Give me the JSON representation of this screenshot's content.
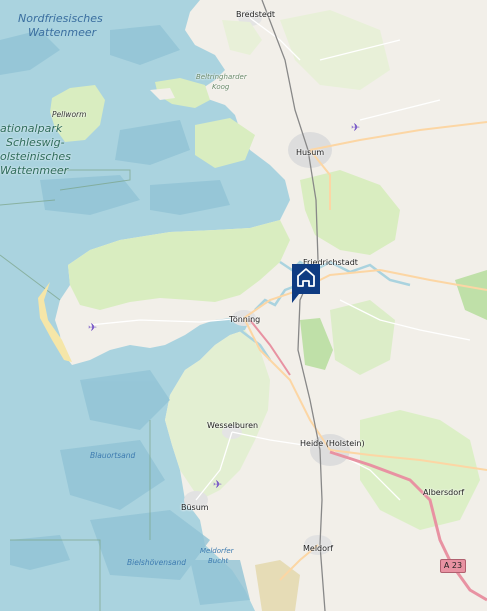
{
  "labels": {
    "nordfriesisches": "Nordfriesisches",
    "wattenmeer_nf": "Wattenmeer",
    "bredstedt": "Bredstedt",
    "beltringharder": "Beltringharder",
    "koog": "Koog",
    "pellworm": "Pellworm",
    "nationalpark_1": "ationalpark",
    "nationalpark_2": "Schleswig-",
    "nationalpark_3": "olsteinisches",
    "nationalpark_4": "Wattenmeer",
    "husum": "Husum",
    "friedrichstadt": "Friedrichstadt",
    "toenning": "Tönning",
    "wesselburen": "Wesselburen",
    "heide": "Heide (Holstein)",
    "albersdorf": "Albersdorf",
    "blauortsand": "Blauortsand",
    "buesum": "Büsum",
    "meldorfer": "Meldorfer",
    "bucht": "Bucht",
    "bielshoevensand": "Bielshövensand",
    "meldorf": "Meldorf",
    "a23": "A 23"
  },
  "icons": {
    "airport": "airport-icon",
    "marker": "home-marker-icon"
  },
  "colors": {
    "sea": "#aad3df",
    "land": "#f2efe9",
    "wetland_green": "#d9edc0",
    "urban": "#dddddd",
    "motorway": "#e892a2",
    "primary": "#fcd6a4",
    "marker": "#0f3b82"
  }
}
